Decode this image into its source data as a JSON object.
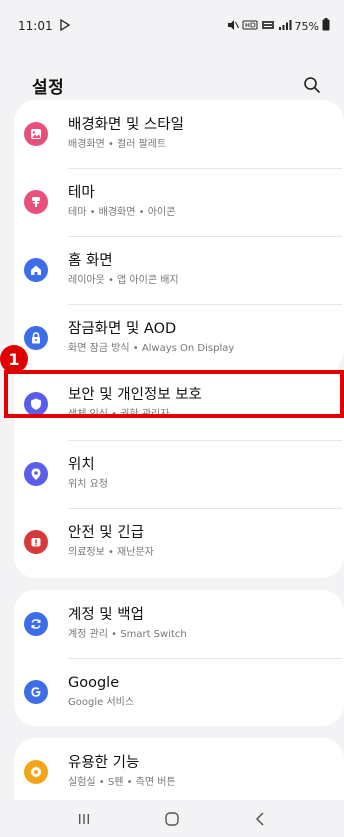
{
  "status": {
    "time": "11:01",
    "battery": "75%"
  },
  "header": {
    "title": "설정"
  },
  "groups": [
    {
      "items": [
        {
          "title": "배경화면 및 스타일",
          "subtitle": "배경화면 • 컬러 팔레트",
          "icon": "wallpaper-icon",
          "color": "#e8507a"
        },
        {
          "title": "테마",
          "subtitle": "테마 • 배경화면 • 아이콘",
          "icon": "theme-icon",
          "color": "#e8507a"
        },
        {
          "title": "홈 화면",
          "subtitle": "레이아웃 • 앱 아이콘 배지",
          "icon": "home-icon",
          "color": "#3d6ee8"
        },
        {
          "title": "잠금화면 및 AOD",
          "subtitle": "화면 잠금 방식 • Always On Display",
          "icon": "lock-icon",
          "color": "#3d6ee8"
        }
      ]
    },
    {
      "items": [
        {
          "title": "보안 및 개인정보 보호",
          "subtitle": "생체 인식 • 권한 관리자",
          "icon": "shield-icon",
          "color": "#5b5ee8"
        },
        {
          "title": "위치",
          "subtitle": "위치 요청",
          "icon": "location-icon",
          "color": "#5b5ee8"
        },
        {
          "title": "안전 및 긴급",
          "subtitle": "의료정보 • 재난문자",
          "icon": "emergency-icon",
          "color": "#d63a3a"
        }
      ]
    },
    {
      "items": [
        {
          "title": "계정 및 백업",
          "subtitle": "계정 관리 • Smart Switch",
          "icon": "sync-icon",
          "color": "#3d6ee8"
        },
        {
          "title": "Google",
          "subtitle": "Google 서비스",
          "icon": "google-icon",
          "color": "#3d6ee8"
        }
      ]
    },
    {
      "items": [
        {
          "title": "유용한 기능",
          "subtitle": "실험실 • S펜 • 측면 버튼",
          "icon": "advanced-features-icon",
          "color": "#f1a51a"
        }
      ]
    }
  ],
  "annotation": {
    "badge_label": "1",
    "highlight_color": "#e00000"
  }
}
